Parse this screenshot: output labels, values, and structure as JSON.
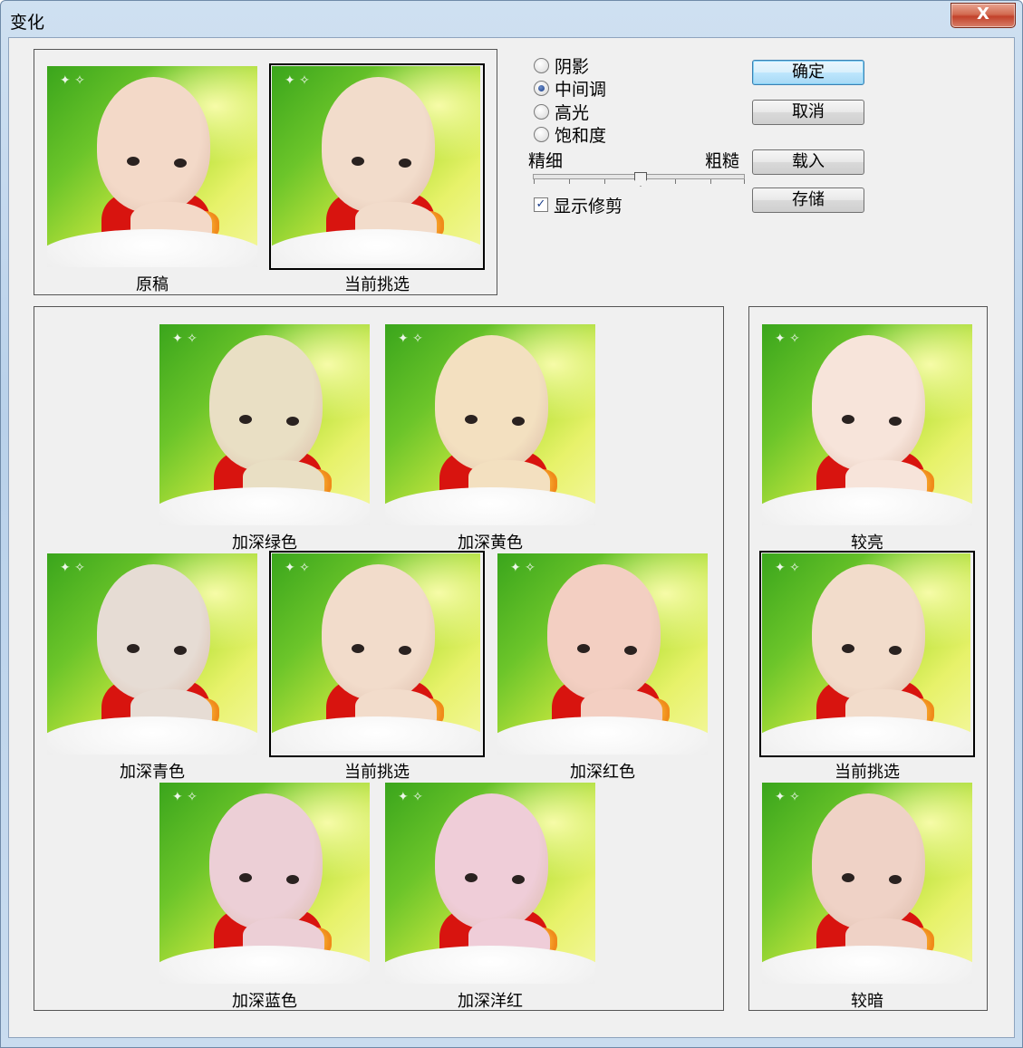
{
  "window": {
    "title": "变化",
    "close_label": "X"
  },
  "options": {
    "radios": [
      {
        "label": "阴影",
        "checked": false
      },
      {
        "label": "中间调",
        "checked": true
      },
      {
        "label": "高光",
        "checked": false
      },
      {
        "label": "饱和度",
        "checked": false
      }
    ],
    "slider": {
      "min_label": "精细",
      "max_label": "粗糙",
      "level": 0.5
    },
    "show_clipping": {
      "label": "显示修剪",
      "checked": true
    }
  },
  "buttons": {
    "ok": "确定",
    "cancel": "取消",
    "load": "载入",
    "save": "存储"
  },
  "preview": {
    "original": "原稿",
    "current": "当前挑选"
  },
  "color_grid": {
    "more_green": "加深绿色",
    "more_yellow": "加深黄色",
    "more_cyan": "加深青色",
    "current": "当前挑选",
    "more_red": "加深红色",
    "more_blue": "加深蓝色",
    "more_magenta": "加深洋红"
  },
  "brightness": {
    "lighter": "较亮",
    "current": "当前挑选",
    "darker": "较暗"
  },
  "tints": {
    "original": "#f3d9c8",
    "current": "#f2dccb",
    "green": "#e9dfc4",
    "yellow": "#f3e0c0",
    "cyan": "#e6dcd4",
    "red": "#f3cfc2",
    "blue": "#eccfd6",
    "magenta": "#efcdd8",
    "lighter": "#f7e4da",
    "darker": "#efd2c6"
  }
}
